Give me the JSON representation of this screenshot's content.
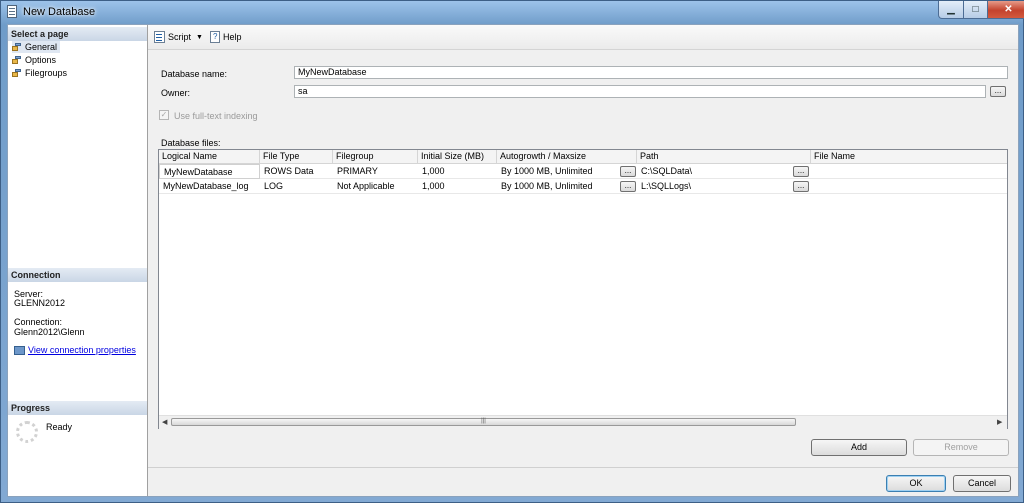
{
  "window": {
    "title": "New Database"
  },
  "left": {
    "select_page_header": "Select a page",
    "pages": [
      {
        "label": "General"
      },
      {
        "label": "Options"
      },
      {
        "label": "Filegroups"
      }
    ],
    "connection_header": "Connection",
    "server_label": "Server:",
    "server_value": "GLENN2012",
    "connection_label": "Connection:",
    "connection_value": "Glenn2012\\Glenn",
    "view_link": "View connection properties",
    "progress_header": "Progress",
    "progress_status": "Ready"
  },
  "toolbar": {
    "script": "Script",
    "help": "Help"
  },
  "form": {
    "db_name_label": "Database name:",
    "db_name_value": "MyNewDatabase",
    "owner_label": "Owner:",
    "owner_value": "sa",
    "fulltext_label": "Use full-text indexing",
    "files_label": "Database files:",
    "ellipsis": "..."
  },
  "table": {
    "columns": [
      "Logical Name",
      "File Type",
      "Filegroup",
      "Initial Size (MB)",
      "Autogrowth / Maxsize",
      "Path",
      "File Name"
    ],
    "rows": [
      {
        "name": "MyNewDatabase",
        "type": "ROWS Data",
        "group": "PRIMARY",
        "size": "1,000",
        "growth": "By 1000 MB, Unlimited",
        "path": "C:\\SQLData\\",
        "file": ""
      },
      {
        "name": "MyNewDatabase_log",
        "type": "LOG",
        "group": "Not Applicable",
        "size": "1,000",
        "growth": "By 1000 MB, Unlimited",
        "path": "L:\\SQLLogs\\",
        "file": ""
      }
    ]
  },
  "buttons": {
    "add": "Add",
    "remove": "Remove",
    "ok": "OK",
    "cancel": "Cancel"
  }
}
